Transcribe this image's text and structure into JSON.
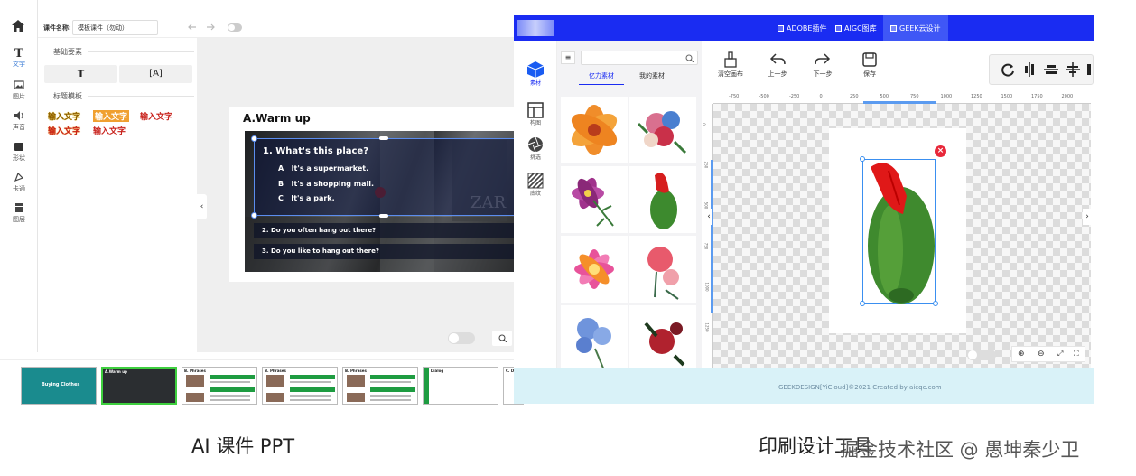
{
  "left_app": {
    "rail": [
      {
        "label": "文字",
        "icon": "text-icon",
        "active": true
      },
      {
        "label": "图片",
        "icon": "image-icon",
        "active": false
      },
      {
        "label": "声音",
        "icon": "sound-icon",
        "active": false
      },
      {
        "label": "形状",
        "icon": "shape-icon",
        "active": false
      },
      {
        "label": "卡通",
        "icon": "cartoon-icon",
        "active": false
      },
      {
        "label": "图层",
        "icon": "layers-icon",
        "active": false
      }
    ],
    "topbar": {
      "name_label": "课件名称:",
      "name_value": "模板课件（勿动）"
    },
    "panel": {
      "section_basic": "基础要素",
      "text_btn": "T",
      "textbox_btn": "[A]",
      "section_title": "标题模板",
      "word_art": [
        {
          "text": "输入文字",
          "color": "#8b5a00",
          "bg": ""
        },
        {
          "text": "输入文字",
          "color": "#ffffff",
          "bg": "#f0a030"
        },
        {
          "text": "输入文字",
          "color": "#c8201a",
          "bg": ""
        },
        {
          "text": "输入文字",
          "color": "#c8201a",
          "bg": ""
        },
        {
          "text": "输入文字",
          "color": "#c8201a",
          "bg": ""
        }
      ]
    },
    "slide": {
      "title": "A.Warm up",
      "question": "1. What's this place?",
      "options": [
        {
          "letter": "A",
          "text": "It's a supermarket."
        },
        {
          "letter": "B",
          "text": "It's a shopping mall."
        },
        {
          "letter": "C",
          "text": "It's a park."
        }
      ],
      "q2": "2. Do you often hang out there?",
      "q3": "3. Do you like to hang out there?"
    },
    "thumbnails": [
      {
        "title": "Buying Clothes",
        "subtitle": "Task Intro",
        "selected": false
      },
      {
        "title": "A.Warm up",
        "subtitle": "",
        "selected": true
      },
      {
        "title": "B. Phrases",
        "subtitle": "",
        "selected": false
      },
      {
        "title": "B. Phrases",
        "subtitle": "",
        "selected": false
      },
      {
        "title": "B. Phrases",
        "subtitle": "",
        "selected": false
      },
      {
        "title": "C. Dialog",
        "subtitle": "",
        "selected": false
      },
      {
        "title": "C. D",
        "subtitle": "",
        "selected": false
      }
    ]
  },
  "right_app": {
    "nav": [
      "ADOBE插件",
      "AIGC图库",
      "GEEK云设计"
    ],
    "rail": [
      {
        "label": "素材",
        "icon": "cube-icon",
        "active": true
      },
      {
        "label": "构图",
        "icon": "layout-icon",
        "active": false
      },
      {
        "label": "挑选",
        "icon": "aperture-icon",
        "active": false
      },
      {
        "label": "底纹",
        "icon": "texture-icon",
        "active": false
      }
    ],
    "library": {
      "tab_a": "亿力素材",
      "tab_b": "我的素材",
      "search_placeholder": ""
    },
    "toolbar": [
      "清空画布",
      "上一步",
      "下一步",
      "保存"
    ],
    "ruler": [
      "-750",
      "-500",
      "-250",
      "0",
      "250",
      "500",
      "750",
      "1000",
      "1250",
      "1500",
      "1750",
      "2000"
    ],
    "vruler": [
      "0",
      "250",
      "500",
      "750",
      "1000",
      "1250"
    ],
    "footer": "GEEKDESIGN[YiCloud]©2021 Created by aicqc.com"
  },
  "captions": {
    "left": "AI 课件 PPT",
    "right": "印刷设计工具",
    "watermark": "掘金技术社区 @ 愚坤秦少卫"
  }
}
